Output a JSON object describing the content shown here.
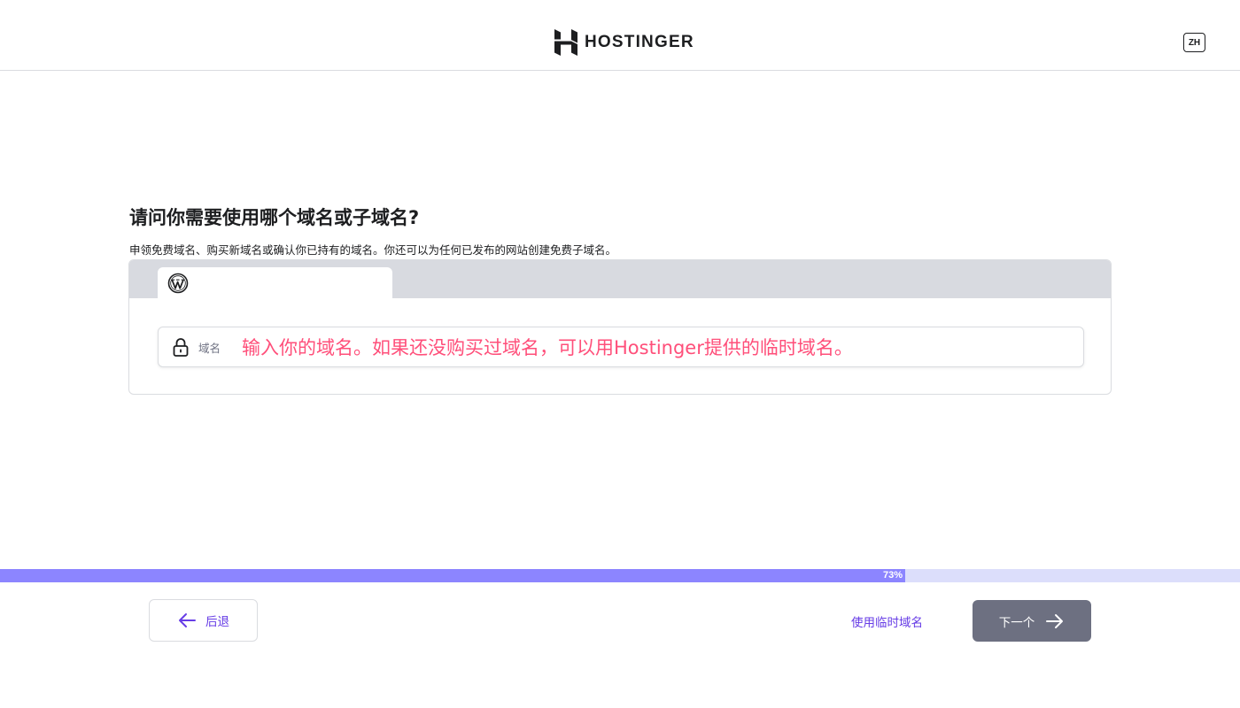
{
  "header": {
    "brand": "HOSTINGER",
    "language": "ZH"
  },
  "main": {
    "title": "请问你需要使用哪个域名或子域名?",
    "description": "申领免费域名、购买新域名或确认你已持有的域名。你还可以为任何已发布的网站创建免费子域名。",
    "tabs": [
      {
        "icon": "wordpress-icon",
        "selected": true
      }
    ],
    "domain_field": {
      "icon": "lock-icon",
      "label": "域名",
      "value": "输入你的域名。如果还没购买过域名，可以用Hostinger提供的临时域名。"
    }
  },
  "progress": {
    "percent": 73,
    "label": "73%"
  },
  "footer": {
    "back_label": "后退",
    "temp_domain_label": "使用临时域名",
    "next_label": "下一个"
  },
  "colors": {
    "accent": "#673de6",
    "progress_fill": "#8c85ff",
    "progress_track": "#dcdefb",
    "input_text": "#ff4f7a",
    "next_button": "#6d7081"
  }
}
